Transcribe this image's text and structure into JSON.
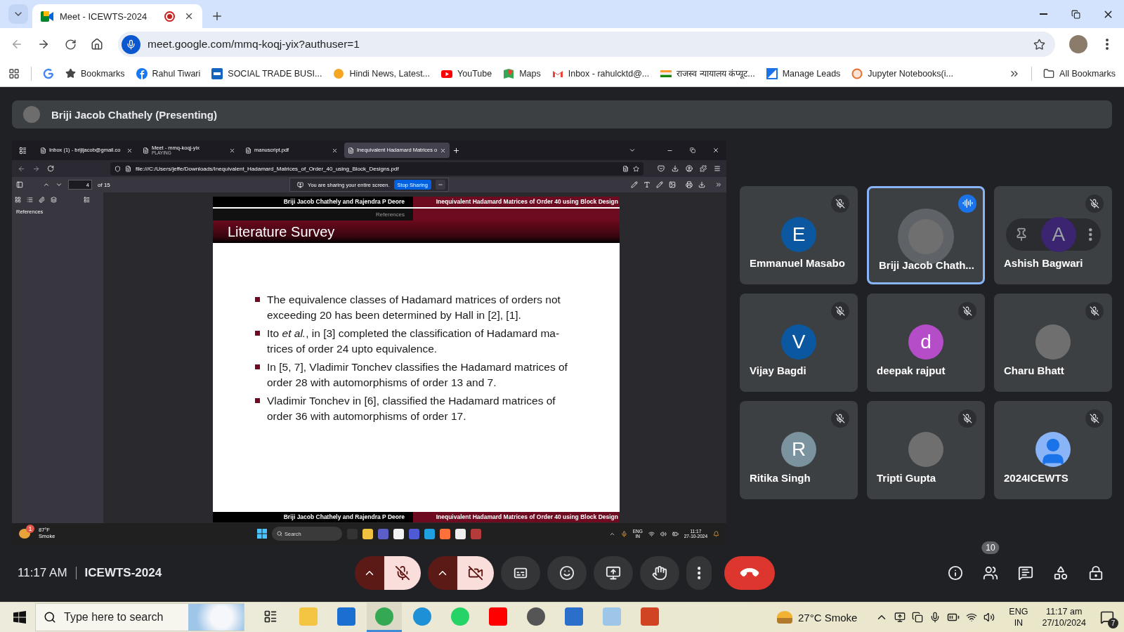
{
  "browser": {
    "tabs": [
      {
        "title": "Meet - ICEWTS-2024",
        "selected": true,
        "recording": true
      }
    ],
    "url": "meet.google.com/mmq-koqj-yix?authuser=1",
    "bookmarks": [
      {
        "kind": "google"
      },
      {
        "kind": "star",
        "label": "Bookmarks"
      },
      {
        "kind": "facebook",
        "label": "Rahul Tiwari"
      },
      {
        "kind": "st",
        "label": "SOCIAL TRADE BUSI..."
      },
      {
        "kind": "orange",
        "label": "Hindi News, Latest..."
      },
      {
        "kind": "youtube",
        "label": "YouTube"
      },
      {
        "kind": "maps",
        "label": "Maps"
      },
      {
        "kind": "gmail",
        "label": "Inbox - rahulcktd@..."
      },
      {
        "kind": "flag",
        "label": "राजस्व न्यायालय कंप्यूट..."
      },
      {
        "kind": "leads",
        "label": "Manage Leads"
      },
      {
        "kind": "jupyter",
        "label": "Jupyter Notebooks(i..."
      }
    ],
    "all_bookmarks": "All Bookmarks"
  },
  "presenter": {
    "name": "Briji Jacob Chathely (Presenting)"
  },
  "shared_screen": {
    "tabs": [
      {
        "title": "Inbox (1) - brijijacob@gmail.co",
        "selected": false
      },
      {
        "title": "Meet - mmq-koqj-yix",
        "subtitle": "PLAYING",
        "selected": false
      },
      {
        "title": "manuscript.pdf",
        "selected": false
      },
      {
        "title": "Inequivalent Hadamard Matrices o",
        "selected": true
      }
    ],
    "url": "file:///C:/Users/jeffe/Downloads/Inequivalent_Hadamard_Matrices_of_Order_40_using_Block_Designs.pdf",
    "page": "4",
    "page_total": "of 15",
    "share_banner": {
      "text": "You are sharing your entire screen.",
      "button": "Stop Sharing"
    },
    "sidebar_label": "References",
    "slide": {
      "header_left": "Briji Jacob Chathely and Rajendra P Deore",
      "header_right": "Inequivalent Hadamard Matrices of Order 40 using Block Design",
      "section": "References",
      "title": "Literature Survey",
      "bullets": [
        {
          "lines": [
            "The equivalence classes of Hadamard matrices of orders not",
            "exceeding 20 has been determined by Hall in [2], [1]."
          ]
        },
        {
          "lines": [
            "Ito *et al.*, in [3] completed the classification of Hadamard ma-",
            "trices of order 24 upto equivalence."
          ]
        },
        {
          "lines": [
            "In [5, 7], Vladimir Tonchev classifies the Hadamard matrices of",
            "order 28 with automorphisms of order 13 and 7."
          ]
        },
        {
          "lines": [
            "Vladimir Tonchev in [6], classified the Hadamard matrices of",
            "order 36 with automorphisms of order 17."
          ]
        }
      ],
      "footer_left": "Briji Jacob Chathely and Rajendra P Deore",
      "footer_right": "Inequivalent Hadamard Matrices of Order 40 using Block Design"
    },
    "taskbar": {
      "temperature": "87°F",
      "weather": "Smoke",
      "weather_badge": "1",
      "placeholder": "Search",
      "lang": "ENG",
      "region": "IN",
      "time": "11:17",
      "date": "27-10-2024"
    }
  },
  "participants": [
    {
      "name": "Emmanuel Masabo",
      "kind": "letter",
      "letter": "E",
      "color": "#0b57a0",
      "muted": true,
      "speaking": false
    },
    {
      "name": "Briji Jacob Chath...",
      "kind": "photo",
      "muted": false,
      "speaking": true
    },
    {
      "name": "Ashish Bagwari",
      "kind": "letter",
      "letter": "A",
      "color": "#3b2470",
      "muted": true,
      "speaking": false,
      "hovered": true
    },
    {
      "name": "Vijay Bagdi",
      "kind": "letter",
      "letter": "V",
      "color": "#0b57a0",
      "muted": true,
      "speaking": false
    },
    {
      "name": "deepak rajput",
      "kind": "letter",
      "letter": "d",
      "color": "#b54cc8",
      "muted": true,
      "speaking": false
    },
    {
      "name": "Charu Bhatt",
      "kind": "photo",
      "muted": true,
      "speaking": false
    },
    {
      "name": "Ritika Singh",
      "kind": "letter",
      "letter": "R",
      "color": "#7b939f",
      "muted": true,
      "speaking": false
    },
    {
      "name": "Tripti Gupta",
      "kind": "photo",
      "muted": true,
      "speaking": false
    },
    {
      "name": "2024ICEWTS",
      "kind": "default",
      "muted": true,
      "speaking": false
    }
  ],
  "call_bar": {
    "time": "11:17 AM",
    "meeting": "ICEWTS-2024",
    "controls": [
      {
        "kind": "mic",
        "on": false
      },
      {
        "kind": "camera",
        "on": false
      },
      {
        "kind": "captions"
      },
      {
        "kind": "emoji"
      },
      {
        "kind": "present"
      },
      {
        "kind": "hand"
      },
      {
        "kind": "more"
      },
      {
        "kind": "end"
      }
    ],
    "people_count": "10"
  },
  "taskbar": {
    "placeholder": "Type here to search",
    "weather": "27°C Smoke",
    "lang": "ENG",
    "region": "IN",
    "time": "11:17 am",
    "date": "27/10/2024",
    "notifications": "7"
  }
}
